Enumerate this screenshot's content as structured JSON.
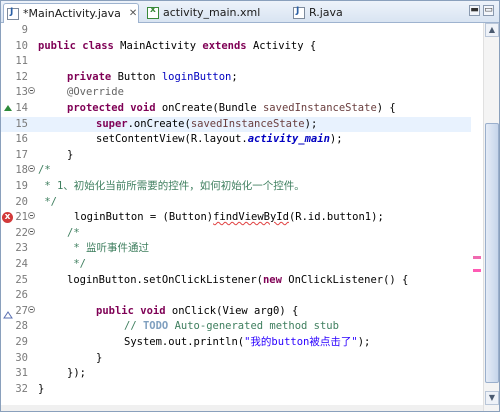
{
  "tabs": [
    {
      "label": "*MainActivity.java",
      "icon": "java-file-icon",
      "close": "✕",
      "active": true
    },
    {
      "label": "activity_main.xml",
      "icon": "xml-file-icon",
      "active": false
    },
    {
      "label": "R.java",
      "icon": "java-file-icon",
      "active": false
    }
  ],
  "window_controls": {
    "minimize": "▬",
    "maximize": "▭"
  },
  "lines": [
    {
      "n": "9"
    },
    {
      "n": "10"
    },
    {
      "n": "11"
    },
    {
      "n": "12"
    },
    {
      "n": "13"
    },
    {
      "n": "14"
    },
    {
      "n": "15"
    },
    {
      "n": "16"
    },
    {
      "n": "17"
    },
    {
      "n": "18"
    },
    {
      "n": "19"
    },
    {
      "n": "20"
    },
    {
      "n": "21"
    },
    {
      "n": "22"
    },
    {
      "n": "23"
    },
    {
      "n": "24"
    },
    {
      "n": "25"
    },
    {
      "n": "26"
    },
    {
      "n": "27"
    },
    {
      "n": "28"
    },
    {
      "n": "29"
    },
    {
      "n": "30"
    },
    {
      "n": "31"
    },
    {
      "n": "32"
    }
  ],
  "code": {
    "l10_kw1": "public class",
    "l10_name": " MainActivity ",
    "l10_kw2": "extends",
    "l10_rest": " Activity {",
    "l12_kw": "private",
    "l12_type": " Button ",
    "l12_field": "loginButton",
    "l12_end": ";",
    "l13_ann": "@Override",
    "l14_kw1": "protected",
    "l14_kw2": " void",
    "l14_rest": " onCreate(Bundle ",
    "l14_param": "savedInstanceState",
    "l14_end": ") {",
    "l15_kw": "super",
    "l15_rest": ".onCreate(",
    "l15_param": "savedInstanceState",
    "l15_end": ");",
    "l16_a": "setContentView(R.layout.",
    "l16_static": "activity_main",
    "l16_end": ");",
    "l17": "}",
    "l18": "/*",
    "l19": " * 1、初始化当前所需要的控件，如何初始化一个控件。",
    "l20": " */",
    "l21_field": "loginButton",
    "l21_a": " = (Button)",
    "l21_err": "findViewById",
    "l21_end": "(R.id.button1);",
    "l22": "/*",
    "l23": " * 监听事件通过",
    "l24": " */",
    "l25_a": "loginButton.setOnClickListener(",
    "l25_kw": "new",
    "l25_end": " OnClickListener() {",
    "l27_kw1": "public",
    "l27_kw2": " void",
    "l27_end": " onClick(View arg0) {",
    "l28_c1": "// ",
    "l28_todo": "TODO",
    "l28_c2": " Auto-generated method stub",
    "l29_a": "System.out.println(",
    "l29_str": "\"我的button被点击了\"",
    "l29_end": ");",
    "l30": "}",
    "l31": "});",
    "l32": "}"
  },
  "error_marker": "x",
  "colors": {
    "keyword": "#7f0055",
    "comment": "#3f7f5f",
    "string": "#2a00ff",
    "field": "#0000c0",
    "current_line": "#e8f2fe",
    "error": "#d23a3a"
  }
}
